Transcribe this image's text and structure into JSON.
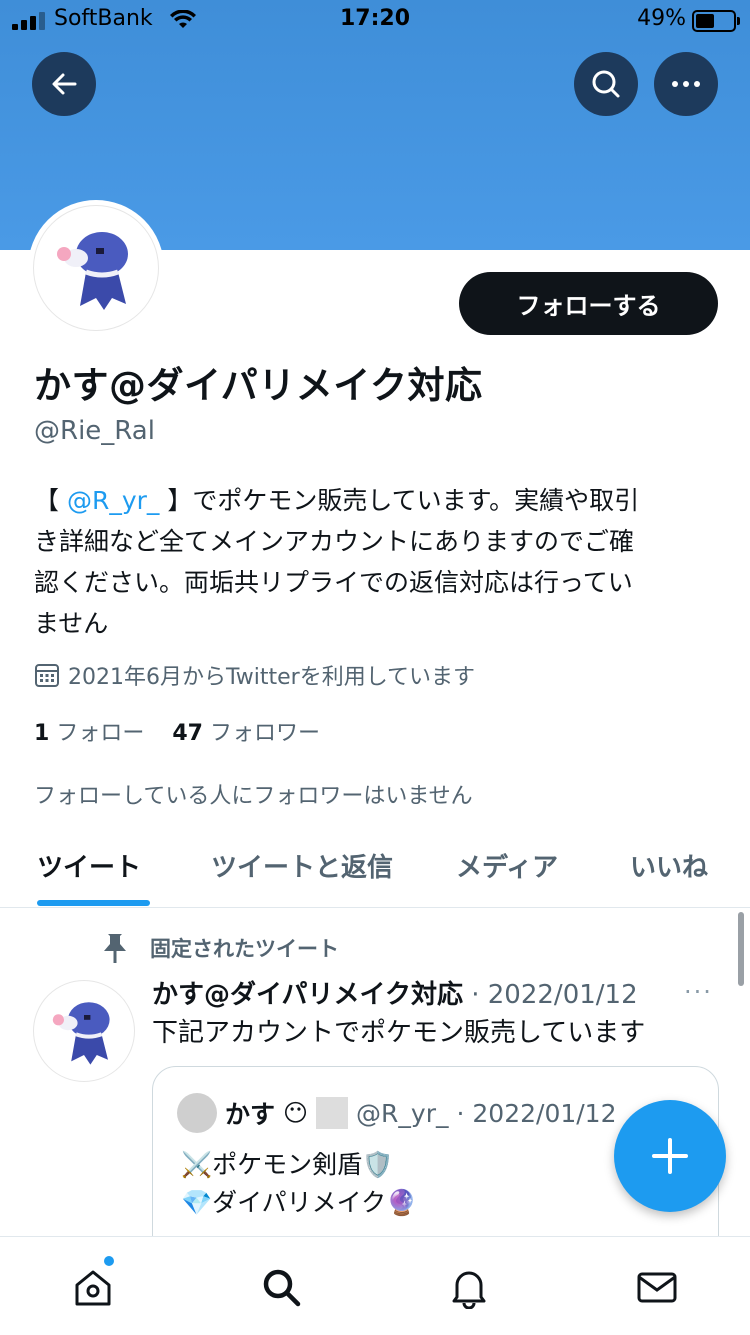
{
  "status_bar": {
    "carrier": "SoftBank",
    "time": "17:20",
    "battery": "49%",
    "battery_level": 0.49
  },
  "header": {
    "back_icon": "arrow-left-icon",
    "search_icon": "search-icon",
    "more_icon": "more-icon",
    "banner_color": "#4a9ae6"
  },
  "profile": {
    "follow_label": "フォローする",
    "display_name": "かす@ダイパリメイク対応",
    "handle": "@Rie_Ral",
    "bio_prefix": "【 ",
    "bio_mention": "@R_yr_",
    "bio_rest_1": " 】でポケモン販売しています。実績や取引",
    "bio_line2": "き詳細など全てメインアカウントにありますのでご確",
    "bio_line3": "認ください。両垢共リプライでの返信対応は行ってい",
    "bio_line4": "ません",
    "joined": "2021年6月からTwitterを利用しています",
    "following_count": "1",
    "following_label": "フォロー",
    "followers_count": "47",
    "followers_label": "フォロワー",
    "no_mutual": "フォローしている人にフォロワーはいません"
  },
  "tabs": [
    {
      "label": "ツイート",
      "active": true
    },
    {
      "label": "ツイートと返信",
      "active": false
    },
    {
      "label": "メディア",
      "active": false
    },
    {
      "label": "いいね",
      "active": false
    }
  ],
  "pinned_tweet": {
    "pinned_label": "固定されたツイート",
    "author_name": "かす@ダイパリメイク対応",
    "date": "· 2022/01/12",
    "text": "下記アカウントでポケモン販売しています",
    "more": "···",
    "quote": {
      "author_name": "かす",
      "handle": "@R_yr_",
      "date": "· 2022/01/12",
      "line1": "⚔️ポケモン剣盾🛡️",
      "line2": "💎ダイパリメイク🔮"
    }
  },
  "bottom_nav": [
    "home-icon",
    "search-icon",
    "bell-icon",
    "mail-icon"
  ],
  "accent_color": "#1d9bf0"
}
